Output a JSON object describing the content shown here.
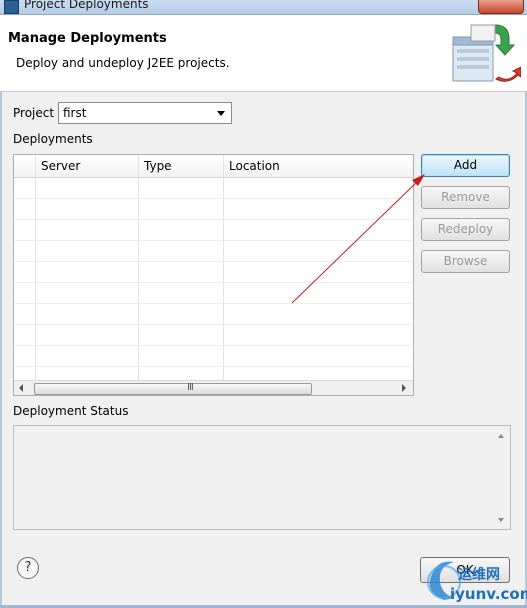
{
  "window": {
    "title": "Project Deployments"
  },
  "banner": {
    "title": "Manage Deployments",
    "description": "Deploy and undeploy J2EE projects."
  },
  "project": {
    "label": "Project",
    "selected": "first"
  },
  "deployments": {
    "label": "Deployments",
    "columns": [
      "Server",
      "Type",
      "Location"
    ],
    "scroll_grip": "III"
  },
  "buttons": {
    "add": "Add",
    "remove": "Remove",
    "redeploy": "Redeploy",
    "browse": "Browse",
    "ok": "OK"
  },
  "status": {
    "label": "Deployment Status"
  },
  "help": {
    "glyph": "?"
  },
  "watermark": {
    "line1": "运维网",
    "line2": "iyunv.com"
  },
  "colors": {
    "accent": "#3c7fb1",
    "arrow": "#c0201e"
  }
}
